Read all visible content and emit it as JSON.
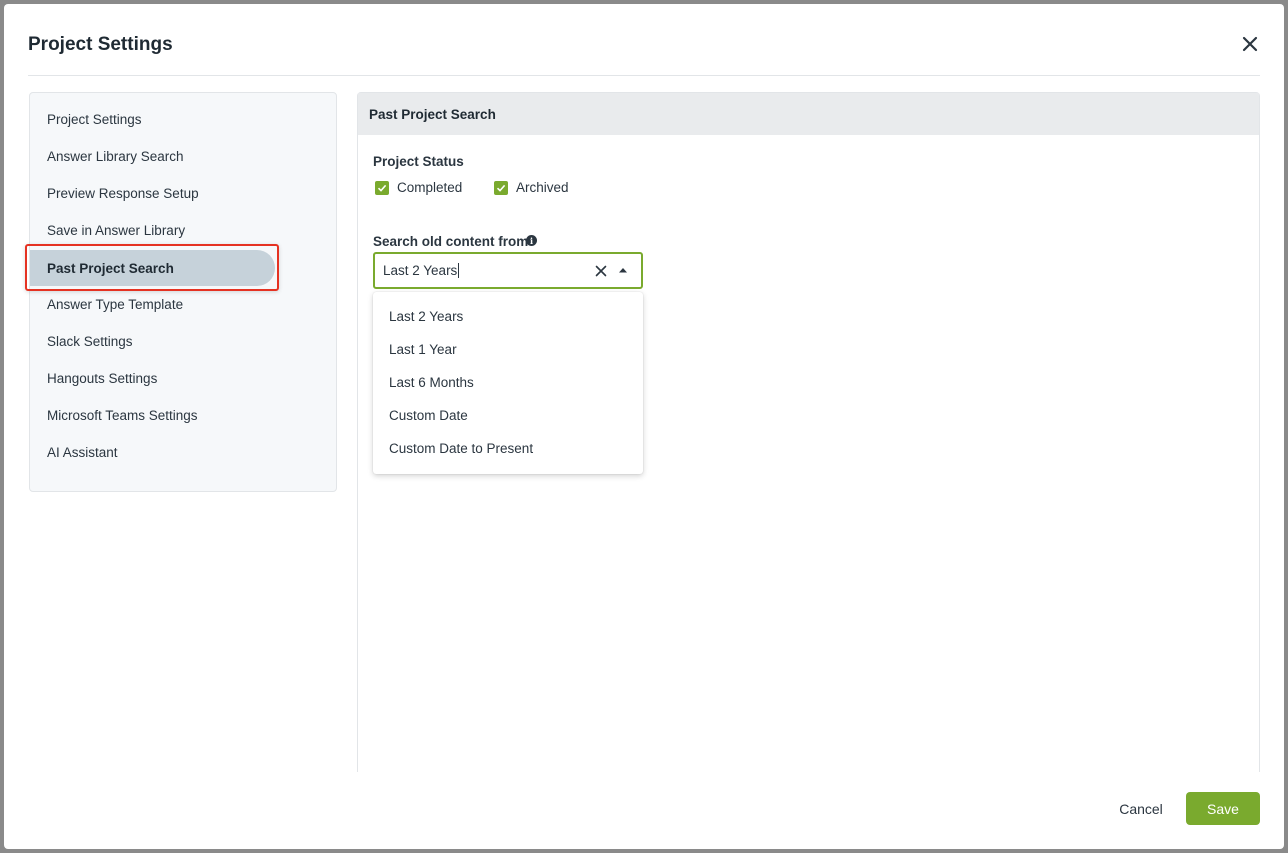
{
  "modal": {
    "title": "Project Settings",
    "close_icon": "close-icon"
  },
  "sidebar": {
    "items": [
      {
        "label": "Project Settings"
      },
      {
        "label": "Answer Library Search"
      },
      {
        "label": "Preview Response Setup"
      },
      {
        "label": "Save in Answer Library"
      },
      {
        "label": "Past Project Search",
        "active": true
      },
      {
        "label": "Answer Type Template"
      },
      {
        "label": "Slack Settings"
      },
      {
        "label": "Hangouts Settings"
      },
      {
        "label": "Microsoft Teams Settings"
      },
      {
        "label": "AI Assistant"
      }
    ]
  },
  "panel": {
    "title": "Past Project Search",
    "project_status": {
      "label": "Project Status",
      "options": [
        {
          "label": "Completed",
          "checked": true
        },
        {
          "label": "Archived",
          "checked": true
        }
      ]
    },
    "search_from": {
      "label": "Search old content from",
      "info_icon": "info-icon",
      "value": "Last 2 Years",
      "options": [
        "Last 2 Years",
        "Last 1 Year",
        "Last 6 Months",
        "Custom Date",
        "Custom Date to Present"
      ]
    }
  },
  "footer": {
    "cancel_label": "Cancel",
    "save_label": "Save"
  },
  "colors": {
    "accent": "#7aaa2e",
    "highlight": "#e53222",
    "active_item_bg": "#c6d2da"
  }
}
